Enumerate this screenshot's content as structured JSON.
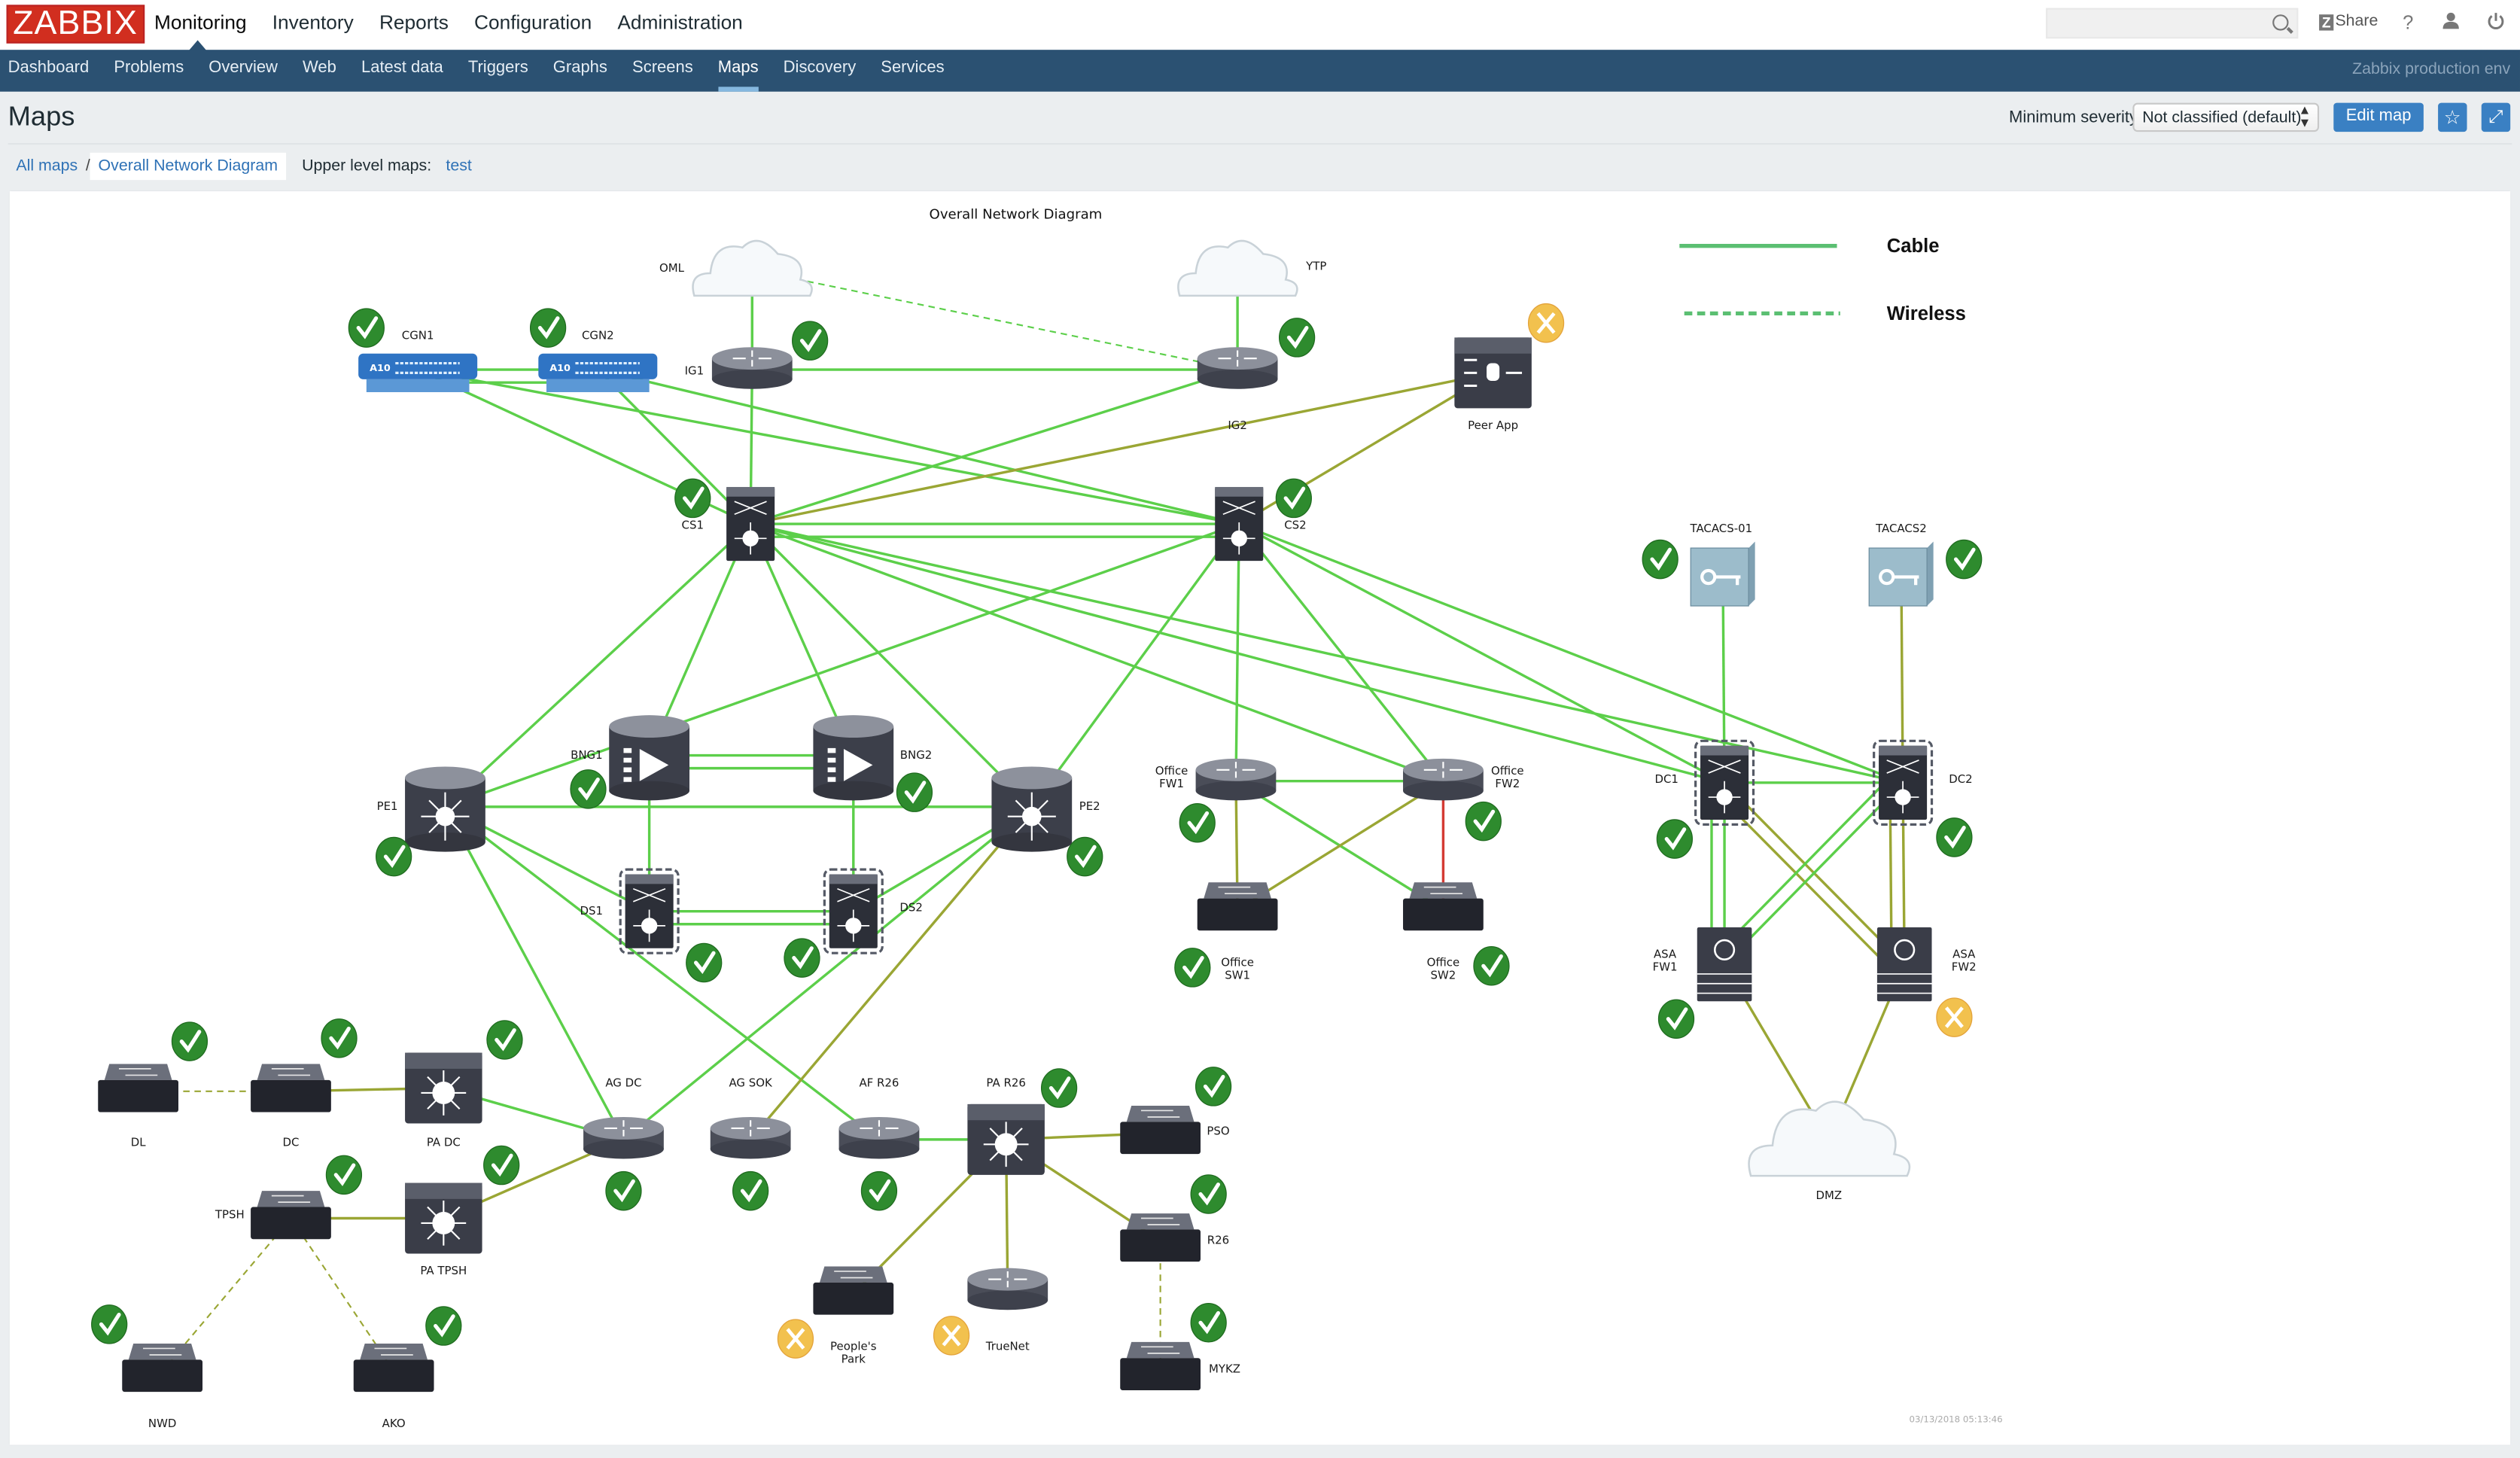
{
  "header": {
    "logo": "ZABBIX",
    "main_menu": [
      "Monitoring",
      "Inventory",
      "Reports",
      "Configuration",
      "Administration"
    ],
    "active_main": "Monitoring",
    "search": {
      "value": "",
      "placeholder": ""
    },
    "share_label": "Share",
    "help_icon": "?",
    "user_icon": "user-icon",
    "logout_icon": "power-icon"
  },
  "subnav": {
    "items": [
      "Dashboard",
      "Problems",
      "Overview",
      "Web",
      "Latest data",
      "Triggers",
      "Graphs",
      "Screens",
      "Maps",
      "Discovery",
      "Services"
    ],
    "active": "Maps",
    "environment": "Zabbix production env"
  },
  "page": {
    "title": "Maps",
    "min_severity_label": "Minimum severity",
    "min_severity_value": "Not classified (default)",
    "edit_map_label": "Edit map",
    "favourite_icon": "star-icon",
    "fullscreen_icon": "fullscreen-icon"
  },
  "breadcrumb": {
    "all_maps": "All maps",
    "separator": "/",
    "current": "Overall Network Diagram",
    "upper_level_label": "Upper level maps:",
    "upper_level_link": "test"
  },
  "map": {
    "title": "Overall Network Diagram",
    "timestamp": "03/13/2018 05:13:46",
    "legend": [
      {
        "label": "Cable",
        "style": "solid"
      },
      {
        "label": "Wireless",
        "style": "dashed"
      }
    ],
    "colors": {
      "ok_link": "#5ccf4a",
      "warn_link": "#9aa634",
      "problem_link": "#d43b34",
      "ok_status": "#2e8b2e",
      "maintenance_status": "#f2c14e",
      "device": "#3c3f4a"
    },
    "nodes": [
      {
        "id": "OML",
        "label": "OML",
        "type": "cloud",
        "status": "none"
      },
      {
        "id": "YTP",
        "label": "YTP",
        "type": "cloud",
        "status": "none"
      },
      {
        "id": "CGN1",
        "label": "CGN1",
        "type": "a10",
        "status": "ok"
      },
      {
        "id": "CGN2",
        "label": "CGN2",
        "type": "a10",
        "status": "ok"
      },
      {
        "id": "IG1",
        "label": "IG1",
        "type": "router",
        "status": "ok"
      },
      {
        "id": "IG2",
        "label": "IG2",
        "type": "router",
        "status": "ok"
      },
      {
        "id": "PEERAPP",
        "label": "Peer App",
        "type": "appliance",
        "status": "maintenance"
      },
      {
        "id": "CS1",
        "label": "CS1",
        "type": "coreswitch",
        "status": "ok"
      },
      {
        "id": "CS2",
        "label": "CS2",
        "type": "coreswitch",
        "status": "ok"
      },
      {
        "id": "TACACS01",
        "label": "TACACS-01",
        "type": "keyserver",
        "status": "ok"
      },
      {
        "id": "TACACS2",
        "label": "TACACS2",
        "type": "keyserver",
        "status": "ok"
      },
      {
        "id": "BNG1",
        "label": "BNG1",
        "type": "bng",
        "status": "ok"
      },
      {
        "id": "BNG2",
        "label": "BNG2",
        "type": "bng",
        "status": "ok"
      },
      {
        "id": "PE1",
        "label": "PE1",
        "type": "pe",
        "status": "ok"
      },
      {
        "id": "PE2",
        "label": "PE2",
        "type": "pe",
        "status": "ok"
      },
      {
        "id": "DS1",
        "label": "DS1",
        "type": "dswitch",
        "status": "ok"
      },
      {
        "id": "DS2",
        "label": "DS2",
        "type": "dswitch",
        "status": "ok"
      },
      {
        "id": "OFW1",
        "label": "Office\nFW1",
        "type": "router",
        "status": "ok"
      },
      {
        "id": "OFW2",
        "label": "Office\nFW2",
        "type": "router",
        "status": "ok"
      },
      {
        "id": "OSW1",
        "label": "Office\nSW1",
        "type": "switch",
        "status": "ok"
      },
      {
        "id": "OSW2",
        "label": "Office\nSW2",
        "type": "switch",
        "status": "ok"
      },
      {
        "id": "DC1",
        "label": "DC1",
        "type": "dswitch",
        "status": "ok"
      },
      {
        "id": "DC2",
        "label": "DC2",
        "type": "dswitch",
        "status": "ok"
      },
      {
        "id": "ASAFW1",
        "label": "ASA\nFW1",
        "type": "firewall",
        "status": "ok"
      },
      {
        "id": "ASAFW2",
        "label": "ASA\nFW2",
        "type": "firewall",
        "status": "maintenance"
      },
      {
        "id": "DMZ",
        "label": "DMZ",
        "type": "cloud",
        "status": "none"
      },
      {
        "id": "DL",
        "label": "DL",
        "type": "switch",
        "status": "ok"
      },
      {
        "id": "DC",
        "label": "DC",
        "type": "switch",
        "status": "ok"
      },
      {
        "id": "PADC",
        "label": "PA DC",
        "type": "l3switch",
        "status": "ok"
      },
      {
        "id": "TPSH",
        "label": "TPSH",
        "type": "switch",
        "status": "ok"
      },
      {
        "id": "PATPSH",
        "label": "PA TPSH",
        "type": "l3switch",
        "status": "ok"
      },
      {
        "id": "NWD",
        "label": "NWD",
        "type": "switch",
        "status": "ok"
      },
      {
        "id": "AKO",
        "label": "AKO",
        "type": "switch",
        "status": "ok"
      },
      {
        "id": "AGDC",
        "label": "AG DC",
        "type": "router",
        "status": "ok"
      },
      {
        "id": "AGSOK",
        "label": "AG SOK",
        "type": "router",
        "status": "ok"
      },
      {
        "id": "AFR26",
        "label": "AF R26",
        "type": "router",
        "status": "ok"
      },
      {
        "id": "PAR26",
        "label": "PA R26",
        "type": "l3switch",
        "status": "ok"
      },
      {
        "id": "PSO",
        "label": "PSO",
        "type": "switch",
        "status": "ok"
      },
      {
        "id": "R26",
        "label": "R26",
        "type": "switch",
        "status": "ok"
      },
      {
        "id": "MYKZ",
        "label": "MYKZ",
        "type": "switch",
        "status": "ok"
      },
      {
        "id": "PEOPLESPARK",
        "label": "People's\nPark",
        "type": "switch",
        "status": "maintenance"
      },
      {
        "id": "TRUENET",
        "label": "TrueNet",
        "type": "router",
        "status": "maintenance"
      }
    ],
    "links": [
      {
        "from": "OML",
        "to": "IG1",
        "state": "ok",
        "style": "solid"
      },
      {
        "from": "OML",
        "to": "IG2",
        "state": "ok",
        "style": "dashed"
      },
      {
        "from": "YTP",
        "to": "IG2",
        "state": "ok",
        "style": "solid"
      },
      {
        "from": "CGN1",
        "to": "CGN2",
        "state": "ok",
        "style": "solid"
      },
      {
        "from": "CGN1",
        "to": "CGN2",
        "state": "ok",
        "style": "solid"
      },
      {
        "from": "IG1",
        "to": "IG2",
        "state": "ok",
        "style": "solid"
      },
      {
        "from": "IG1",
        "to": "CS1",
        "state": "ok",
        "style": "solid"
      },
      {
        "from": "IG2",
        "to": "CS1",
        "state": "ok",
        "style": "solid"
      },
      {
        "from": "CGN1",
        "to": "CS1",
        "state": "ok",
        "style": "solid"
      },
      {
        "from": "CGN1",
        "to": "CS2",
        "state": "ok",
        "style": "solid"
      },
      {
        "from": "CGN2",
        "to": "CS1",
        "state": "ok",
        "style": "solid"
      },
      {
        "from": "CGN2",
        "to": "CS2",
        "state": "ok",
        "style": "solid"
      },
      {
        "from": "PEERAPP",
        "to": "CS1",
        "state": "warn",
        "style": "solid"
      },
      {
        "from": "PEERAPP",
        "to": "CS2",
        "state": "warn",
        "style": "solid"
      },
      {
        "from": "CS1",
        "to": "CS2",
        "state": "ok",
        "style": "solid"
      },
      {
        "from": "CS1",
        "to": "CS2",
        "state": "ok",
        "style": "solid"
      },
      {
        "from": "CS1",
        "to": "PE1",
        "state": "ok",
        "style": "solid"
      },
      {
        "from": "CS1",
        "to": "BNG1",
        "state": "ok",
        "style": "solid"
      },
      {
        "from": "CS1",
        "to": "PE2",
        "state": "ok",
        "style": "solid"
      },
      {
        "from": "CS1",
        "to": "BNG2",
        "state": "ok",
        "style": "solid"
      },
      {
        "from": "CS1",
        "to": "OFW2",
        "state": "ok",
        "style": "solid"
      },
      {
        "from": "CS1",
        "to": "DC1",
        "state": "ok",
        "style": "solid"
      },
      {
        "from": "CS1",
        "to": "DC2",
        "state": "ok",
        "style": "solid"
      },
      {
        "from": "CS2",
        "to": "PE1",
        "state": "ok",
        "style": "solid"
      },
      {
        "from": "CS2",
        "to": "PE2",
        "state": "ok",
        "style": "solid"
      },
      {
        "from": "CS2",
        "to": "OFW1",
        "state": "ok",
        "style": "solid"
      },
      {
        "from": "CS2",
        "to": "OFW2",
        "state": "ok",
        "style": "solid"
      },
      {
        "from": "CS2",
        "to": "DC1",
        "state": "ok",
        "style": "solid"
      },
      {
        "from": "CS2",
        "to": "DC2",
        "state": "ok",
        "style": "solid"
      },
      {
        "from": "TACACS01",
        "to": "DC1",
        "state": "ok",
        "style": "solid"
      },
      {
        "from": "TACACS2",
        "to": "DC2",
        "state": "warn",
        "style": "solid"
      },
      {
        "from": "DC1",
        "to": "DC2",
        "state": "ok",
        "style": "solid"
      },
      {
        "from": "DC1",
        "to": "ASAFW1",
        "state": "ok",
        "style": "solid"
      },
      {
        "from": "DC1",
        "to": "ASAFW1",
        "state": "ok",
        "style": "solid"
      },
      {
        "from": "DC1",
        "to": "ASAFW2",
        "state": "warn",
        "style": "solid"
      },
      {
        "from": "DC1",
        "to": "ASAFW2",
        "state": "warn",
        "style": "solid"
      },
      {
        "from": "DC2",
        "to": "ASAFW1",
        "state": "ok",
        "style": "solid"
      },
      {
        "from": "DC2",
        "to": "ASAFW1",
        "state": "ok",
        "style": "solid"
      },
      {
        "from": "DC2",
        "to": "ASAFW2",
        "state": "warn",
        "style": "solid"
      },
      {
        "from": "DC2",
        "to": "ASAFW2",
        "state": "warn",
        "style": "solid"
      },
      {
        "from": "ASAFW1",
        "to": "DMZ",
        "state": "warn",
        "style": "solid"
      },
      {
        "from": "ASAFW2",
        "to": "DMZ",
        "state": "warn",
        "style": "solid"
      },
      {
        "from": "BNG1",
        "to": "BNG2",
        "state": "ok",
        "style": "solid"
      },
      {
        "from": "BNG1",
        "to": "BNG2",
        "state": "ok",
        "style": "solid"
      },
      {
        "from": "BNG1",
        "to": "DS1",
        "state": "ok",
        "style": "solid"
      },
      {
        "from": "BNG2",
        "to": "DS2",
        "state": "ok",
        "style": "solid"
      },
      {
        "from": "PE1",
        "to": "PE2",
        "state": "ok",
        "style": "solid"
      },
      {
        "from": "PE1",
        "to": "DS1",
        "state": "ok",
        "style": "solid"
      },
      {
        "from": "PE2",
        "to": "DS2",
        "state": "ok",
        "style": "solid"
      },
      {
        "from": "DS1",
        "to": "DS2",
        "state": "ok",
        "style": "solid"
      },
      {
        "from": "DS1",
        "to": "DS2",
        "state": "ok",
        "style": "solid"
      },
      {
        "from": "PE1",
        "to": "AGDC",
        "state": "ok",
        "style": "solid"
      },
      {
        "from": "PE1",
        "to": "AFR26",
        "state": "ok",
        "style": "solid"
      },
      {
        "from": "PE2",
        "to": "AGDC",
        "state": "ok",
        "style": "solid"
      },
      {
        "from": "PE2",
        "to": "AGSOK",
        "state": "warn",
        "style": "solid"
      },
      {
        "from": "OFW1",
        "to": "OFW2",
        "state": "ok",
        "style": "solid"
      },
      {
        "from": "OFW1",
        "to": "OSW1",
        "state": "warn",
        "style": "solid"
      },
      {
        "from": "OFW1",
        "to": "OSW2",
        "state": "ok",
        "style": "solid"
      },
      {
        "from": "OFW2",
        "to": "OSW1",
        "state": "warn",
        "style": "solid"
      },
      {
        "from": "OFW2",
        "to": "OSW2",
        "state": "problem",
        "style": "solid"
      },
      {
        "from": "DL",
        "to": "DC",
        "state": "warn",
        "style": "dashed"
      },
      {
        "from": "DC",
        "to": "PADC",
        "state": "warn",
        "style": "solid"
      },
      {
        "from": "PADC",
        "to": "AGDC",
        "state": "ok",
        "style": "solid"
      },
      {
        "from": "TPSH",
        "to": "PATPSH",
        "state": "warn",
        "style": "solid"
      },
      {
        "from": "PATPSH",
        "to": "AGDC",
        "state": "warn",
        "style": "solid"
      },
      {
        "from": "TPSH",
        "to": "NWD",
        "state": "warn",
        "style": "dashed"
      },
      {
        "from": "TPSH",
        "to": "AKO",
        "state": "warn",
        "style": "dashed"
      },
      {
        "from": "AFR26",
        "to": "PAR26",
        "state": "ok",
        "style": "solid"
      },
      {
        "from": "PAR26",
        "to": "PSO",
        "state": "warn",
        "style": "solid"
      },
      {
        "from": "PAR26",
        "to": "PEOPLESPARK",
        "state": "warn",
        "style": "solid"
      },
      {
        "from": "PAR26",
        "to": "TRUENET",
        "state": "warn",
        "style": "solid"
      },
      {
        "from": "PAR26",
        "to": "R26",
        "state": "warn",
        "style": "solid"
      },
      {
        "from": "R26",
        "to": "MYKZ",
        "state": "warn",
        "style": "dashed"
      }
    ]
  }
}
